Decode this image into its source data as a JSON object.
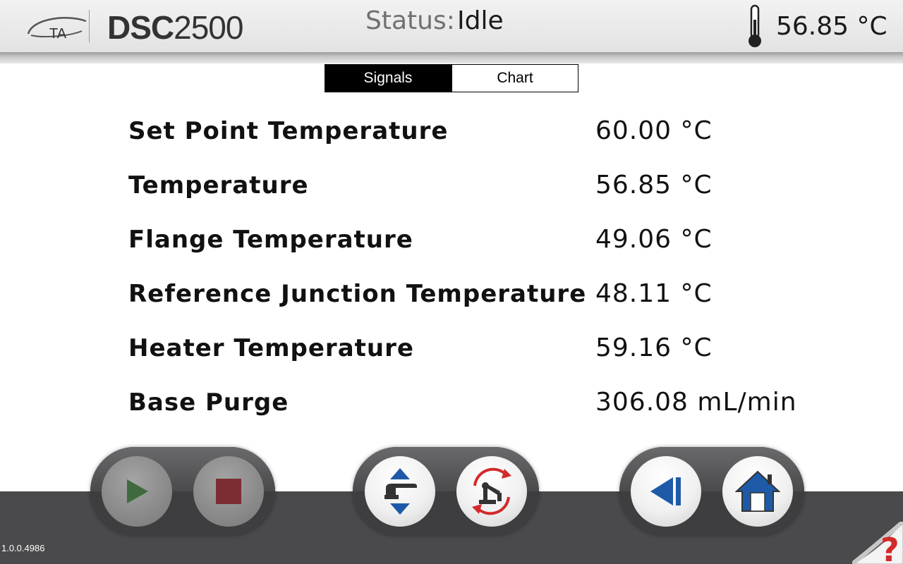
{
  "header": {
    "logo_text": "TA",
    "product_bold": "DSC",
    "product_number": "2500",
    "status_label": "Status:",
    "status_value": "Idle",
    "current_temperature": "56.85 °C"
  },
  "tabs": [
    {
      "label": "Signals",
      "active": true
    },
    {
      "label": "Chart",
      "active": false
    }
  ],
  "signals": [
    {
      "label": "Set Point Temperature",
      "value": "60.00 °C"
    },
    {
      "label": "Temperature",
      "value": "56.85 °C"
    },
    {
      "label": "Flange Temperature",
      "value": "49.06 °C"
    },
    {
      "label": "Reference Junction Temperature",
      "value": "48.11 °C"
    },
    {
      "label": "Heater Temperature",
      "value": "59.16 °C"
    },
    {
      "label": "Base Purge",
      "value": "306.08 mL/min"
    }
  ],
  "controls": {
    "start_icon": "play-icon",
    "stop_icon": "stop-icon",
    "lid_icon": "lid-up-down-icon",
    "autosampler_icon": "autosampler-icon",
    "back_icon": "back-icon",
    "home_icon": "home-icon"
  },
  "colors": {
    "play": "#3f6a3f",
    "stop": "#7a2d33",
    "blue": "#1e5aa8",
    "red_arrows": "#d32a2a",
    "bottom_bar": "#4a4a4c"
  },
  "footer": {
    "version": "1.0.0.4986",
    "help_symbol": "?"
  }
}
